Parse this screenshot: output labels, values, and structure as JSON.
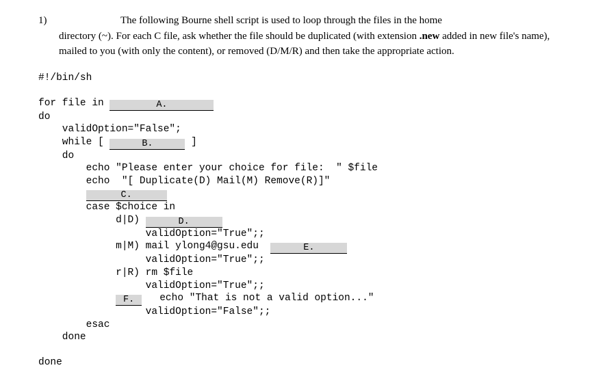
{
  "question": {
    "number": "1)",
    "line1": "The following Bourne shell script is used to loop through the files in the home",
    "line2": "directory (~). For each C file, ask whether the file should be duplicated (with extension ",
    "bold_ext": ".new",
    "line3": " added in new file's name), mailed to you (with only the content), or removed (D/M/R) and then take the appropriate action."
  },
  "code": {
    "shebang": "#!/bin/sh",
    "for_kw": "for file in ",
    "do1": "do",
    "validOpt": "    validOption=\"False\";",
    "while_pre": "    while [ ",
    "while_post": " ]",
    "do2": "    do",
    "echo1": "        echo \"Please enter your choice for file:  \" $file",
    "echo2": "        echo  \"[ Duplicate(D) Mail(M) Remove(R)]\"",
    "indent_c": "        ",
    "case_line": "        case $choice in",
    "dD_pre": "             d|D) ",
    "dD_valid": "                  validOption=\"True\";;",
    "mM_pre": "             m|M) mail ylong4@gsu.edu  ",
    "mM_valid": "                  validOption=\"True\";;",
    "rR_line": "             r|R) rm $file",
    "rR_valid": "                  validOption=\"True\";;",
    "f_pre": "             ",
    "f_post": "   echo \"That is not a valid option...\"",
    "f_valid": "                  validOption=\"False\";;",
    "esac": "        esac",
    "done2": "    done",
    "done1": "done"
  },
  "blanks": {
    "a": "A.",
    "b": "B.",
    "c": "C.",
    "d": "D.",
    "e": "E.",
    "f": "F."
  }
}
